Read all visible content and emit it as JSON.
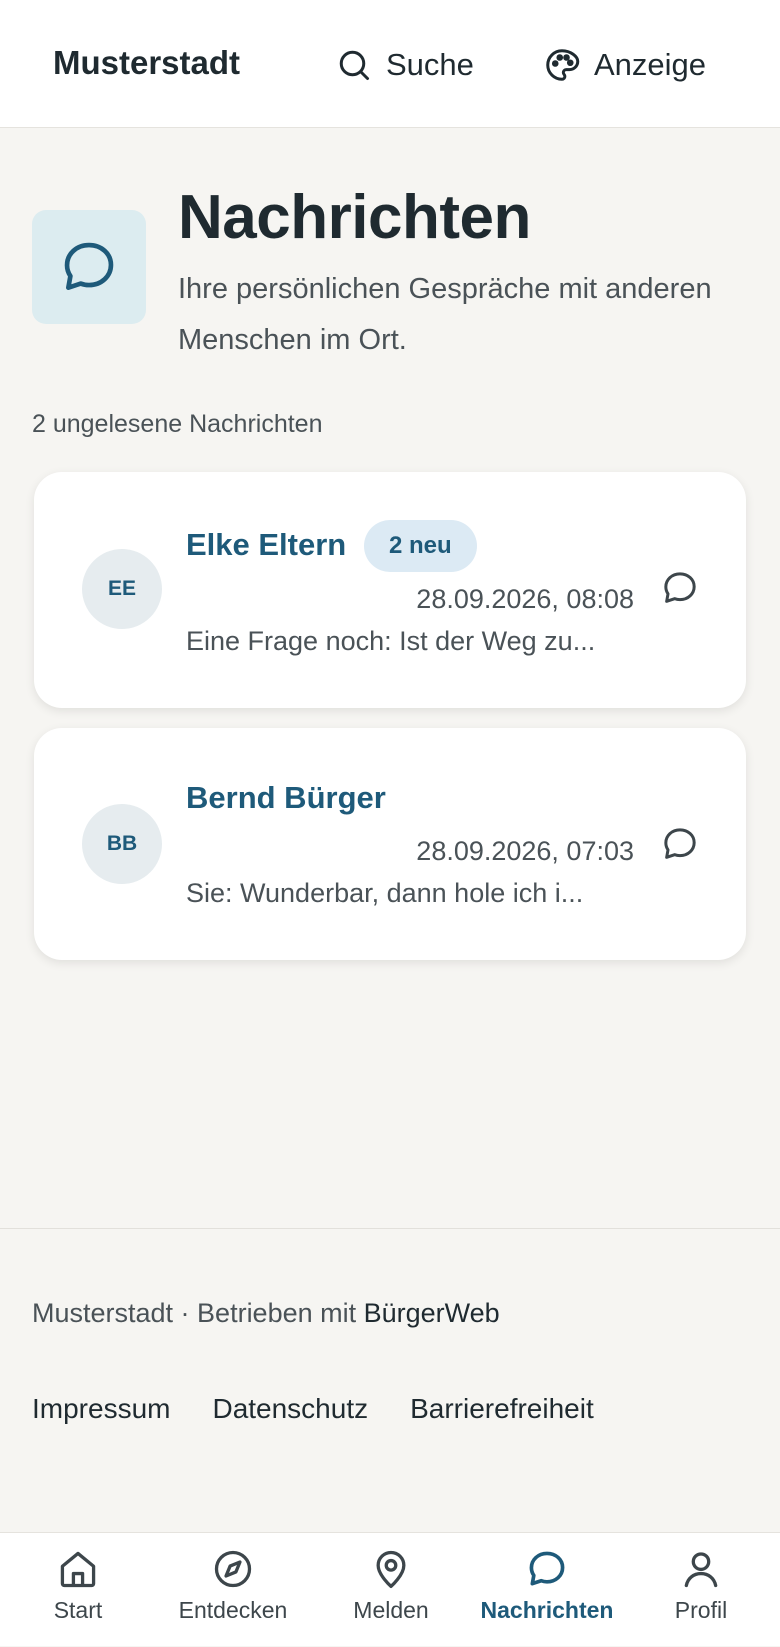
{
  "header": {
    "brand": "Musterstadt",
    "search_label": "Suche",
    "display_label": "Anzeige"
  },
  "page": {
    "title": "Nachrichten",
    "subtitle": "Ihre persönlichen Gespräche mit anderen Menschen im Ort.",
    "unread_text": "2 ungelesene Nachrichten"
  },
  "conversations": [
    {
      "initials": "EE",
      "name": "Elke Eltern",
      "badge": "2 neu",
      "time": "28.09.2026, 08:08",
      "preview": "Eine Frage noch: Ist der Weg zu..."
    },
    {
      "initials": "BB",
      "name": "Bernd Bürger",
      "badge": "",
      "time": "28.09.2026, 07:03",
      "preview": "Sie: Wunderbar, dann hole ich i..."
    }
  ],
  "footer": {
    "brand_text": "Musterstadt · Betrieben mit ",
    "powered_by": "BürgerWeb",
    "links": [
      "Impressum",
      "Datenschutz",
      "Barrierefreiheit"
    ]
  },
  "bottom_nav": {
    "items": [
      {
        "label": "Start",
        "icon": "home-icon"
      },
      {
        "label": "Entdecken",
        "icon": "compass-icon"
      },
      {
        "label": "Melden",
        "icon": "map-pin-icon"
      },
      {
        "label": "Nachrichten",
        "icon": "message-icon"
      },
      {
        "label": "Profil",
        "icon": "user-icon"
      }
    ],
    "active_index": 3
  },
  "colors": {
    "accent": "#1e5a7a",
    "background": "#f6f5f2",
    "badge_bg": "#dceaf4",
    "hero_icon_bg": "#dcecf0"
  }
}
